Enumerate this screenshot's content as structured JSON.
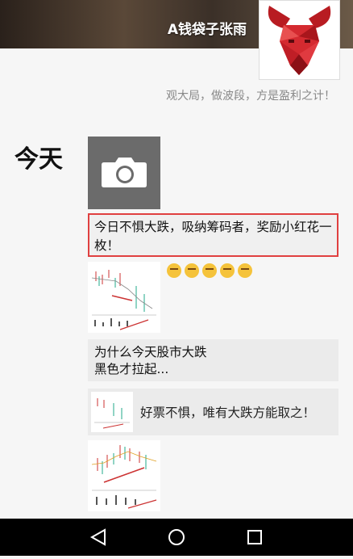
{
  "profile": {
    "name": "A钱袋子张雨",
    "signature": "观大局，做波段，方是盈利之计！"
  },
  "timeline": {
    "day_label": "今天",
    "post1_text": "今日不惧大跌，吸纳筹码者，奖励小红花一枚！",
    "post3_line1": "为什么今天股市大跌",
    "post3_line2": "黑色才拉起...",
    "post4_text": "好票不惧，唯有大跌方能取之！"
  },
  "icons": {
    "camera": "camera-icon",
    "avatar": "red-bull-skull-logo",
    "emoji": "thinking-face-emoji",
    "nav_back": "triangle-back-icon",
    "nav_home": "circle-home-icon",
    "nav_recent": "square-recent-icon"
  },
  "colors": {
    "highlight_border": "#e04040",
    "navbar": "#000000"
  }
}
